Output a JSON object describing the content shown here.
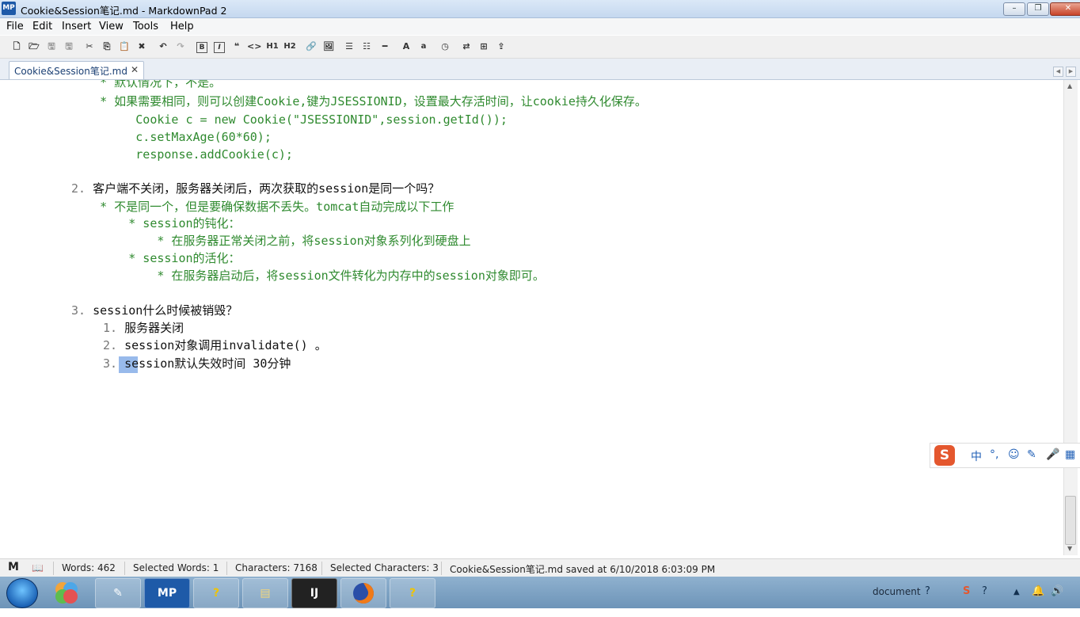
{
  "window": {
    "title": "Cookie&Session笔记.md - MarkdownPad 2",
    "app_icon": "MP",
    "buttons": [
      "–",
      "❐",
      "✕"
    ]
  },
  "menu": [
    "File",
    "Edit",
    "Insert",
    "View",
    "Tools",
    "Help"
  ],
  "toolbar": {
    "icons": [
      "new-document-icon",
      "open-folder-icon",
      "save-icon",
      "save-all-icon",
      "cut-icon",
      "copy-icon",
      "paste-icon",
      "delete-icon",
      "undo-icon",
      "redo-icon",
      "bold-icon",
      "italic-icon",
      "quote-icon",
      "code-icon",
      "h1-icon",
      "h2-icon",
      "link-icon",
      "image-icon",
      "unordered-list-icon",
      "ordered-list-icon",
      "horizontal-rule-icon",
      "uppercase-icon",
      "lowercase-icon",
      "timestamp-icon",
      "preview-icon",
      "browser-preview-icon",
      "export-icon"
    ],
    "labels": {
      "bold": "B",
      "italic": "I",
      "quote": "❝",
      "code": "<>",
      "h1": "H1",
      "h2": "H2",
      "upper": "A",
      "lower": "a"
    }
  },
  "tab": {
    "label": "Cookie&Session笔记.md",
    "close": "✕"
  },
  "editor": {
    "lines": [
      {
        "cls": "g",
        "text": "    * 默认情况下，不是。"
      },
      {
        "cls": "g",
        "text": "    * 如果需要相同，则可以创建Cookie,键为JSESSIONID，设置最大存活时间，让cookie持久化保存。"
      },
      {
        "cls": "g",
        "text": "         Cookie c = new Cookie(\"JSESSIONID\",session.getId());"
      },
      {
        "cls": "g",
        "text": "         c.setMaxAge(60*60);"
      },
      {
        "cls": "g",
        "text": "         response.addCookie(c);"
      },
      {
        "cls": "k",
        "num": "2.",
        "text": " 客户端不关闭，服务器关闭后，两次获取的session是同一个吗？"
      },
      {
        "cls": "g",
        "text": "    * 不是同一个，但是要确保数据不丢失。tomcat自动完成以下工作"
      },
      {
        "cls": "g",
        "text": "        * session的钝化："
      },
      {
        "cls": "g",
        "text": "            * 在服务器正常关闭之前，将session对象系列化到硬盘上"
      },
      {
        "cls": "g",
        "text": "        * session的活化："
      },
      {
        "cls": "g",
        "text": "            * 在服务器启动后，将session文件转化为内存中的session对象即可。"
      },
      {
        "cls": "k",
        "num": "3.",
        "text": " session什么时候被销毁？"
      },
      {
        "cls": "k",
        "num": "1.",
        "text": " 服务器关闭"
      },
      {
        "cls": "k",
        "num": "2.",
        "text": " session对象调用invalidate() 。"
      },
      {
        "cls": "k",
        "num": "3.",
        "text": " session默认失效时间 30分钟"
      }
    ]
  },
  "ime": {
    "logo": "S",
    "items": [
      "中",
      "°,",
      "☺",
      "✎",
      "🎤",
      "▦"
    ]
  },
  "status": {
    "md_icon": "M",
    "book_icon": "📖",
    "words": "Words: 462",
    "selected_words": "Selected Words: 1",
    "characters": "Characters: 7168",
    "selected_characters": "Selected Characters: 3",
    "saved": "Cookie&Session笔记.md saved at 6/10/2018 6:03:09 PM"
  },
  "taskbar": {
    "apps": [
      {
        "name": "taskbar-app-pictures",
        "glyph": ""
      },
      {
        "name": "taskbar-app-paint",
        "glyph": "✎"
      },
      {
        "name": "taskbar-app-markdownpad",
        "glyph": "MP"
      },
      {
        "name": "taskbar-app-help-1",
        "glyph": "?"
      },
      {
        "name": "taskbar-app-explorer",
        "glyph": "▤"
      },
      {
        "name": "taskbar-app-intellij",
        "glyph": "IJ"
      },
      {
        "name": "taskbar-app-firefox",
        "glyph": ""
      },
      {
        "name": "taskbar-app-help-2",
        "glyph": "?"
      }
    ],
    "tray_text": "document",
    "tray_icons": [
      "?",
      "S",
      "?",
      "▲",
      "🔔",
      "🔊"
    ]
  }
}
